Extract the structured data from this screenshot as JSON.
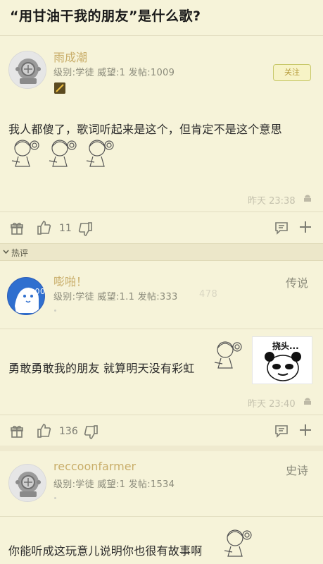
{
  "question_title": "“用甘油干我的朋友”是什么歌?",
  "hot_section_label": "热评",
  "posts": [
    {
      "username": "雨成潮",
      "meta": "级别:学徒 威望:1 发帖:1009",
      "follow_label": "关注",
      "content": "我人都傻了，歌词听起来是这个，但肯定不是这个意思",
      "time": "昨天 23:38",
      "likes": "11"
    },
    {
      "username": "嘭啪！",
      "meta": "级别:学徒 威望:1.1 发帖:333",
      "rank_tag": "传说",
      "content": "勇敢勇敢我的朋友 就算明天没有彩虹",
      "meme_text": "挠头...",
      "time": "昨天 23:40",
      "likes": "136",
      "watermark": "0.00",
      "watermark2": "478"
    },
    {
      "username": "reccoonfarmer",
      "meta": "级别:学徒 威望:1 发帖:1534",
      "rank_tag": "史诗",
      "content": "你能听成这玩意儿说明你也很有故事啊"
    }
  ],
  "icons": {
    "gift": "gift-icon",
    "like": "thumbs-up-icon",
    "dislike": "thumbs-down-icon",
    "comment": "comment-icon",
    "more": "plus-icon",
    "android": "android-icon",
    "chevron": "chevron-down-icon"
  },
  "colors": {
    "background": "#f6f3d9",
    "username": "#c9ae6a",
    "follow_border": "#c8c86a"
  }
}
